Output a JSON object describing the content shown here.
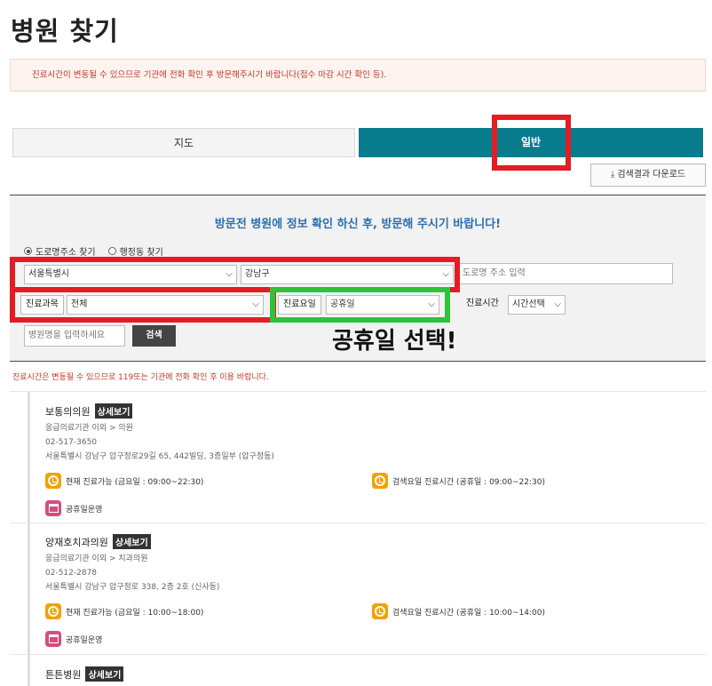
{
  "page": {
    "title": "병원 찾기",
    "notice": "진료시간이 변동될 수 있으므로 기관에 전화 확인 후 방문해주시기 바랍니다(접수 마감 시간 확인 등)."
  },
  "tabs": [
    {
      "label": "지도",
      "active": false
    },
    {
      "label": "일반",
      "active": true
    }
  ],
  "download_label": "검색결과 다운로드",
  "search": {
    "heading": "방문전 병원에 정보 확인 하신 후, 방문해 주시기 바랍니다!",
    "radio_road": "도로명주소 찾기",
    "radio_admin": "행정동 찾기",
    "city": "서울특별시",
    "district": "강남구",
    "road_placeholder": "도로명 주소 입력",
    "dept_label": "진료과목",
    "dept_value": "전체",
    "day_label": "진료요일",
    "day_value": "공휴일",
    "time_label": "진료시간",
    "time_value": "시간선택",
    "name_placeholder": "병원명을 입력하세요",
    "search_button": "검색"
  },
  "annotation": {
    "callout": "공휴일 선택!"
  },
  "warning": "진료시간은 변동될 수 있으므로 119또는 기관에 전화 확인 후 이용 바랍니다.",
  "hospitals": [
    {
      "name": "보통의의원",
      "detail": "상세보기",
      "category": "응급의료기관 이외 > 의원",
      "phone": "02-517-3650",
      "address": "서울특별시 강남구 압구정로29길 65, 442빌딩, 3층일부 (압구정동)",
      "now": "현재 진료가능 (금요일 : 09:00~22:30)",
      "searched": "검색요일 진료시간 (공휴일 : 09:00~22:30)",
      "holiday": "공휴일운영"
    },
    {
      "name": "양재호치과의원",
      "detail": "상세보기",
      "category": "응급의료기관 이외 > 치과의원",
      "phone": "02-512-2878",
      "address": "서울특별시 강남구 압구정로 338, 2층 2호 (신사동)",
      "now": "현재 진료가능 (금요일 : 10:00~18:00)",
      "searched": "검색요일 진료시간 (공휴일 : 10:00~14:00)",
      "holiday": "공휴일운영"
    },
    {
      "name": "튼튼병원",
      "detail": "상세보기"
    }
  ],
  "icons": {
    "clock": "clock-icon",
    "calendar": "calendar-icon",
    "download": "download-icon",
    "chevron": "chevron-down-icon"
  },
  "colors": {
    "accent": "#087b8d",
    "heading_blue": "#2a6fb0",
    "warning_red": "#c0392b",
    "highlight_red": "#e51c23",
    "highlight_green": "#2fc23b",
    "clock_orange": "#f5a000",
    "calendar_pink": "#d64c7f"
  }
}
